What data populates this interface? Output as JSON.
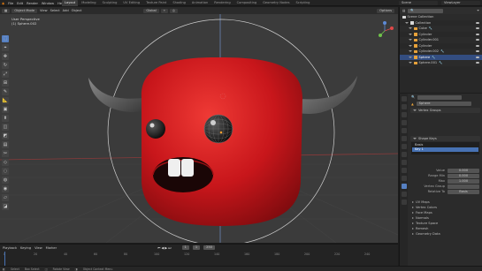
{
  "menu": [
    "File",
    "Edit",
    "Render",
    "Window",
    "Help"
  ],
  "workspaces": [
    "Layout",
    "Modeling",
    "Sculpting",
    "UV Editing",
    "Texture Paint",
    "Shading",
    "Animation",
    "Rendering",
    "Compositing",
    "Geometry Nodes",
    "Scripting"
  ],
  "active_workspace": "Layout",
  "scene": "Scene",
  "view_layer": "ViewLayer",
  "viewport_header": {
    "mode": "Object Mode",
    "menus": [
      "View",
      "Select",
      "Add",
      "Object"
    ],
    "orientation": "Global",
    "options": "Options"
  },
  "viewport_overlay": {
    "line1": "User Perspective",
    "line2": "(1) Sphere.002"
  },
  "outliner": {
    "title": "Scene Collection",
    "items": [
      {
        "name": "Scene Collection",
        "level": 0,
        "color": "#d8d8d8",
        "selected": false
      },
      {
        "name": "Collection",
        "level": 1,
        "color": "#d8d8d8",
        "selected": false
      },
      {
        "name": "Cube",
        "level": 2,
        "color": "#e8a23a",
        "selected": false
      },
      {
        "name": "Cylinder",
        "level": 2,
        "color": "#e8a23a",
        "selected": false
      },
      {
        "name": "Cylinder.001",
        "level": 2,
        "color": "#e8a23a",
        "selected": false
      },
      {
        "name": "Cylinder",
        "level": 2,
        "color": "#e8a23a",
        "selected": false
      },
      {
        "name": "Cylinder.002",
        "level": 2,
        "color": "#e8a23a",
        "selected": false
      },
      {
        "name": "Sphere",
        "level": 2,
        "color": "#e8a23a",
        "selected": true
      },
      {
        "name": "Sphere.001",
        "level": 2,
        "color": "#e8a23a",
        "selected": false
      }
    ]
  },
  "properties": {
    "object_name": "Sphere",
    "section_shape": "Vertex Groups",
    "section_weights": "Shape Keys",
    "vertex_groups": [
      "Basis",
      "Key 1"
    ],
    "value_label": "Value",
    "value": "0.000",
    "range_min_label": "Range Min",
    "range_min": "0.000",
    "max_label": "Max",
    "max": "1.000",
    "vertex_group_label": "Vertex Group",
    "relative_label": "Relative To",
    "relative_value": "Basis",
    "subpanels": [
      "UV Maps",
      "Vertex Colors",
      "Face Maps",
      "Normals",
      "Texture Space",
      "Remesh",
      "Geometry Data"
    ]
  },
  "timeline": {
    "menus": [
      "Playback",
      "Keying",
      "View",
      "Marker"
    ],
    "frame_labels": [
      "0",
      "20",
      "40",
      "60",
      "80",
      "100",
      "120",
      "140",
      "160",
      "180",
      "200",
      "220",
      "240"
    ],
    "current_frame": "1",
    "start": "1",
    "end": "250"
  },
  "status_bar": [
    "Select",
    "Box Select",
    "Rotate View",
    "Object Context Menu"
  ],
  "colors": {
    "accent": "#4772b3",
    "monster_body": "#c8161b",
    "horns": "#5e5e5e",
    "background": "#3b3b3b"
  }
}
